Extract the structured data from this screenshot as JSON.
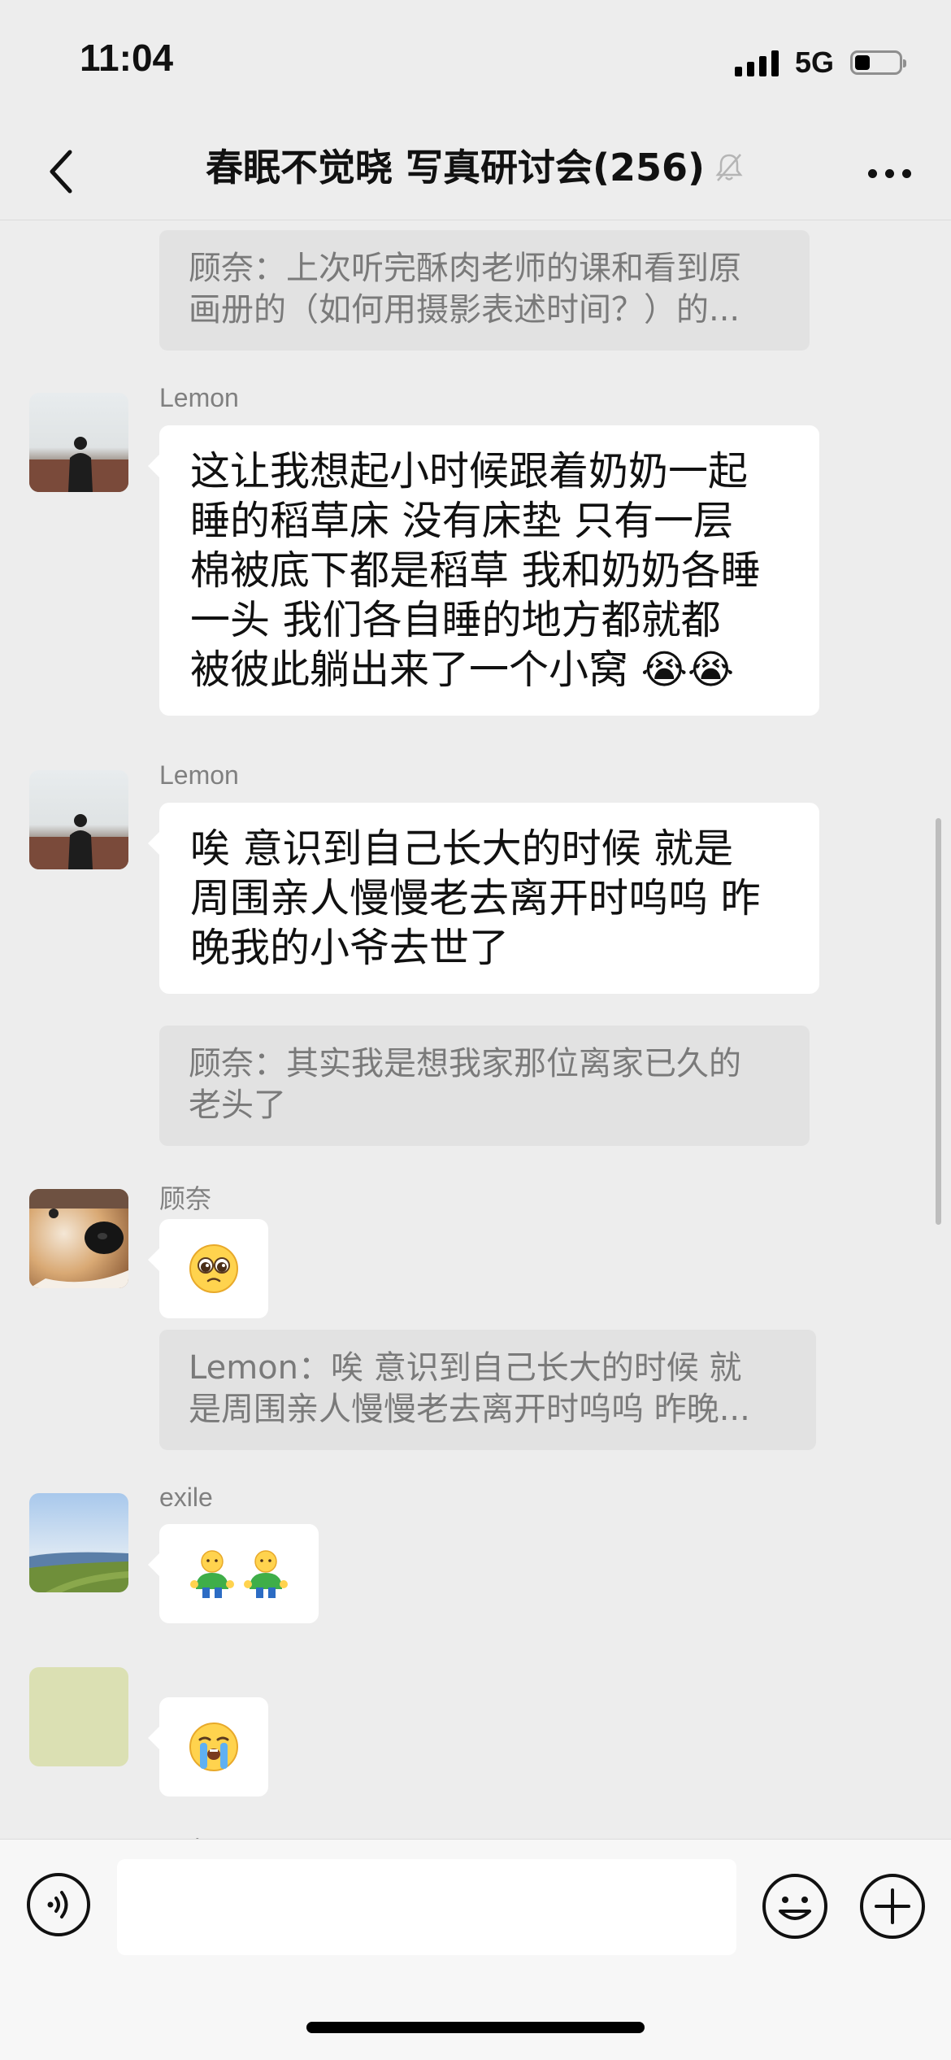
{
  "status_bar": {
    "time": "11:04",
    "network": "5G",
    "battery_level": 0.35
  },
  "nav": {
    "title": "春眠不觉晓 写真研讨会(256)",
    "back_icon": "chevron-left-icon",
    "mute_icon": "bell-off-icon",
    "more_icon": "more-dots-icon"
  },
  "messages": [
    {
      "type": "quote",
      "lines": [
        "顾奈：上次听完酥肉老师的课和看到原",
        "画册的（如何用摄影表述时间？）的..."
      ]
    },
    {
      "type": "text",
      "sender": "Lemon",
      "avatar": "person-silhouette-avatar",
      "lines": [
        "这让我想起小时候跟着奶奶一起",
        "睡的稻草床 没有床垫 只有一层",
        "棉被底下都是稻草 我和奶奶各睡",
        "一头  我们各自睡的地方都就都",
        "被彼此躺出来了一个小窝 😭😭"
      ]
    },
    {
      "type": "text",
      "sender": "Lemon",
      "avatar": "person-silhouette-avatar",
      "lines": [
        "唉 意识到自己长大的时候 就是",
        "周围亲人慢慢老去离开时呜呜 昨",
        "晚我的小爷去世了"
      ]
    },
    {
      "type": "quote",
      "lines": [
        "顾奈：其实我是想我家那位离家已久的",
        "老头了"
      ]
    },
    {
      "type": "emoji",
      "sender": "顾奈",
      "avatar": "dog-avatar",
      "emoji": "🥺"
    },
    {
      "type": "quote",
      "lines": [
        "Lemon：唉 意识到自己长大的时候 就",
        "是周围亲人慢慢老去离开时呜呜 昨晚..."
      ]
    },
    {
      "type": "emoji",
      "sender": "exile",
      "avatar": "landscape-avatar",
      "emoji": "🧍🧍"
    },
    {
      "type": "emoji",
      "sender": "",
      "avatar": "plain-green-avatar",
      "emoji": "😭"
    }
  ],
  "partial_sender": "顾奈",
  "input_bar": {
    "voice_icon": "voice-icon",
    "emoji_icon": "smile-icon",
    "plus_icon": "plus-circle-icon",
    "placeholder": ""
  },
  "colors": {
    "background": "#EDEDED",
    "bubble": "#FFFFFF",
    "quote": "#E2E2E2",
    "sender_name": "#808080"
  }
}
